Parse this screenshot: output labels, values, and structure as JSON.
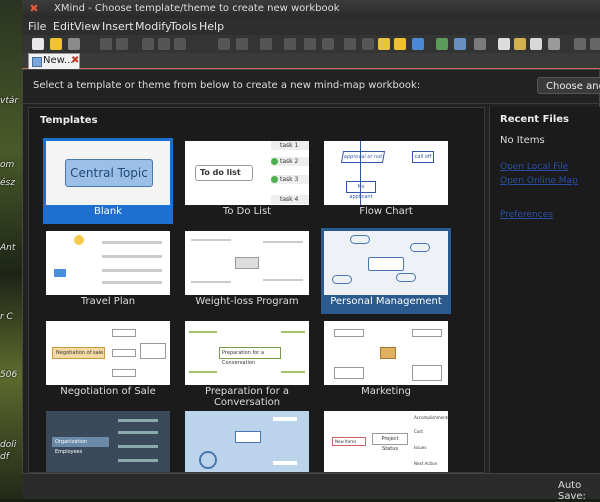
{
  "window": {
    "title": "XMind - Choose template/theme to create new workbook",
    "close_glyph": "✖"
  },
  "desktop": {
    "texts": [
      "vtár",
      "om",
      "ész",
      "Ant",
      "r C",
      "506",
      "doli",
      "df"
    ]
  },
  "menu": [
    "File",
    "Edit",
    "View",
    "Insert",
    "Modify",
    "Tools",
    "Help"
  ],
  "tab": {
    "label": "New...",
    "close": "✖"
  },
  "header": {
    "instruction": "Select a template or theme from below to create a new mind-map workbook:",
    "choose_button": "Choose and C"
  },
  "templates": {
    "heading": "Templates",
    "items": [
      {
        "label": "Blank",
        "state": "selected"
      },
      {
        "label": "To Do List",
        "state": "normal"
      },
      {
        "label": "Flow Chart",
        "state": "normal"
      },
      {
        "label": "Travel Plan",
        "state": "normal"
      },
      {
        "label": "Weight-loss Program",
        "state": "normal"
      },
      {
        "label": "Personal Management",
        "state": "hover"
      },
      {
        "label": "Negotiation of Sale",
        "state": "normal"
      },
      {
        "label": "Preparation for a Conversation",
        "state": "normal"
      },
      {
        "label": "Marketing",
        "state": "normal"
      }
    ],
    "thumb_text": {
      "central_topic": "Central Topic",
      "todo_list": "To do list",
      "tasks": [
        "task 1",
        "task 2",
        "task 3",
        "task 4"
      ],
      "flow_nodes": [
        "approval or not",
        "call off",
        "No applicant"
      ],
      "negotiation": "Negotiation of sale",
      "preparation": "Preparation for a Conversation",
      "org": "Organization Employees",
      "project": "Project Status",
      "project_nodes": [
        "Accomplishments",
        "Cost",
        "Issues",
        "Next Action"
      ],
      "new_items": "New Items"
    }
  },
  "recent": {
    "heading": "Recent Files",
    "empty": "No Items",
    "links": [
      "Open Local File",
      "Open Online Map",
      "Preferences"
    ]
  },
  "status": {
    "autosave": "Auto Save:"
  },
  "colors": {
    "selected": "#1e6fd0",
    "hover": "#2b5a8e",
    "accent_orange": "#e05a3a",
    "central_topic_fill": "#9bbfe6"
  }
}
